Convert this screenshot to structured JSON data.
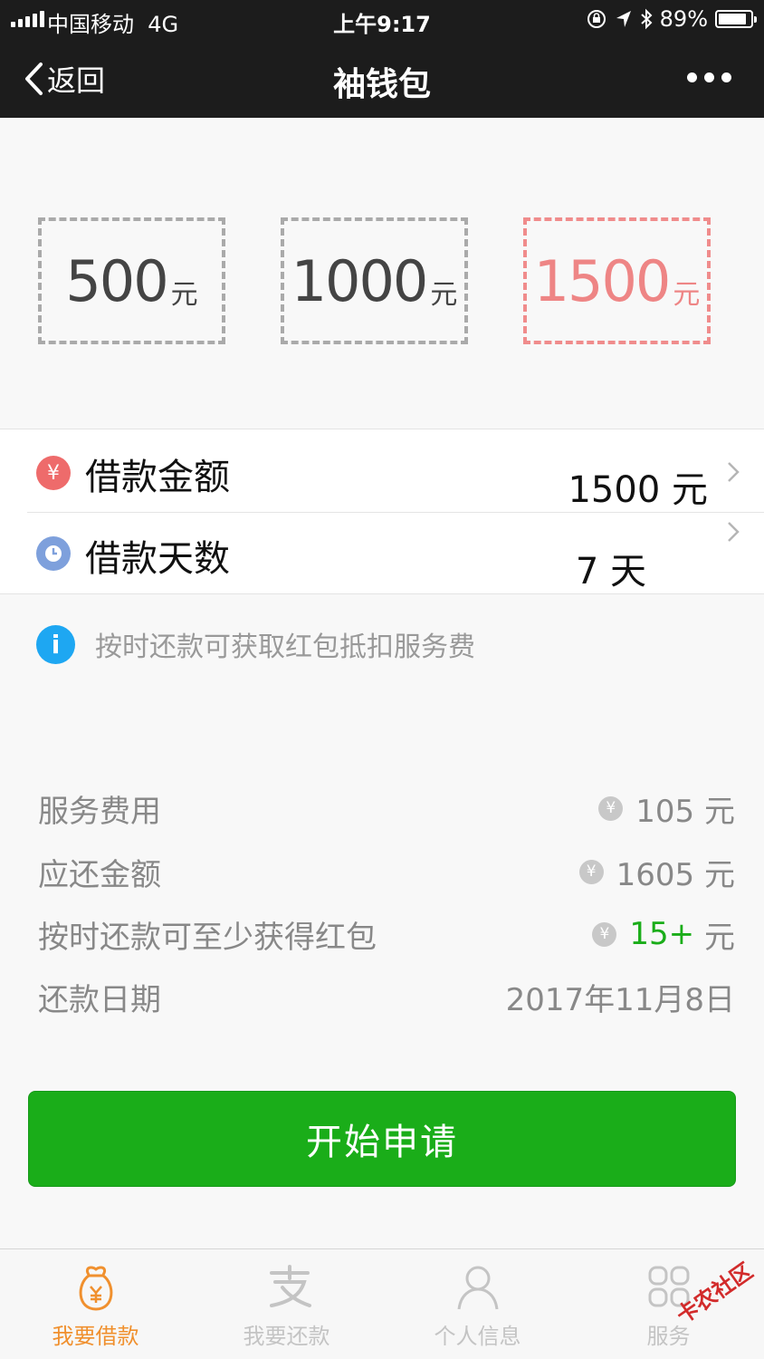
{
  "status_bar": {
    "carrier": "中国移动",
    "network": "4G",
    "time": "上午9:17",
    "battery": "89%"
  },
  "nav": {
    "back_label": "返回",
    "title": "袖钱包"
  },
  "amounts": [
    {
      "value": "500",
      "unit": "元"
    },
    {
      "value": "1000",
      "unit": "元"
    },
    {
      "value": "1500",
      "unit": "元"
    }
  ],
  "selected_amount_index": 2,
  "rows": {
    "loan_amount": {
      "label": "借款金额",
      "value": "1500 元",
      "icon": "yen-icon"
    },
    "loan_days": {
      "label": "借款天数",
      "value": "7 天",
      "icon": "clock-icon"
    }
  },
  "notice": "按时还款可获取红包抵扣服务费",
  "details": {
    "service_fee": {
      "label": "服务费用",
      "value": "105 元"
    },
    "repay_amount": {
      "label": "应还金额",
      "value": "1605 元"
    },
    "red_packet": {
      "label": "按时还款可至少获得红包",
      "value": "15+",
      "unit": "元"
    },
    "repay_date": {
      "label": "还款日期",
      "value": "2017年11月8日"
    }
  },
  "apply_button": "开始申请",
  "tabs": [
    {
      "label": "我要借款",
      "icon": "money-bag-icon",
      "active": true
    },
    {
      "label": "我要还款",
      "icon": "alipay-icon",
      "active": false
    },
    {
      "label": "个人信息",
      "icon": "person-icon",
      "active": false
    },
    {
      "label": "服务",
      "icon": "grid-icon",
      "active": false
    }
  ],
  "watermark": "卡农社区",
  "colors": {
    "accent_green": "#1aad19",
    "selected": "#ee8585",
    "tab_active": "#f0902e",
    "info": "#1ea7f2"
  }
}
